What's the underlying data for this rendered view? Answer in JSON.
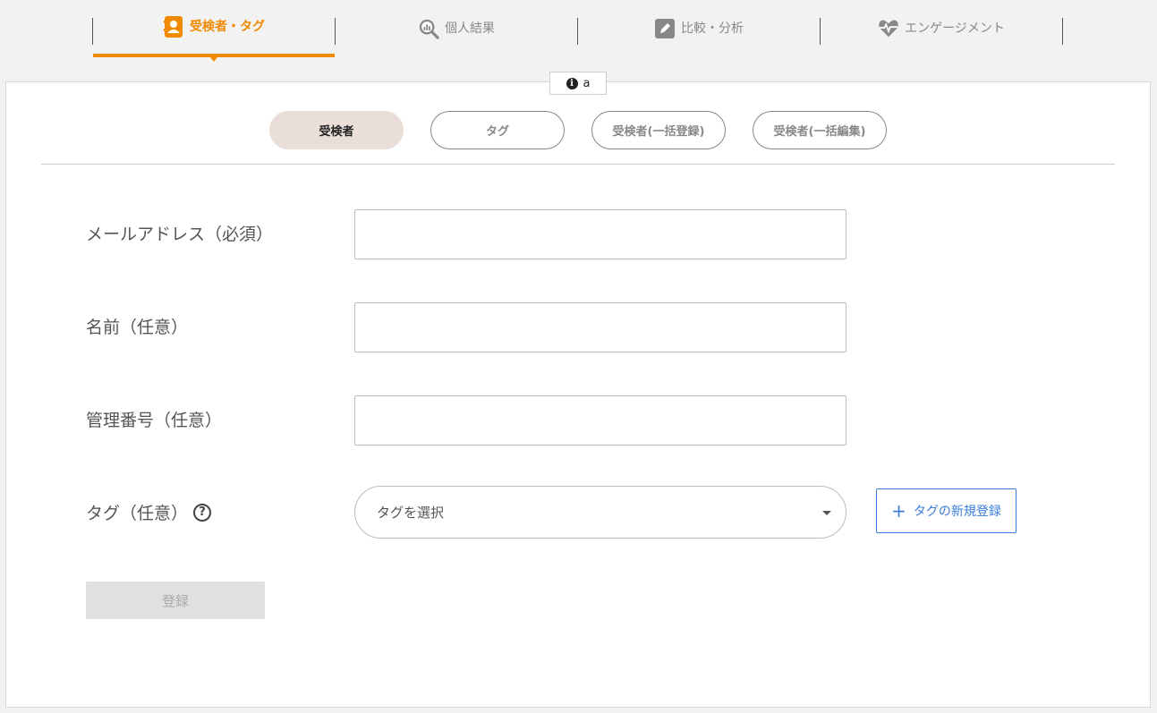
{
  "nav": {
    "tabs": [
      {
        "label": "受検者・タグ",
        "icon": "contact-book-icon",
        "active": true
      },
      {
        "label": "個人結果",
        "icon": "magnify-chart-icon",
        "active": false
      },
      {
        "label": "比較・分析",
        "icon": "pencil-square-icon",
        "active": false
      },
      {
        "label": "エンゲージメント",
        "icon": "heartbeat-icon",
        "active": false
      }
    ]
  },
  "info_chip": {
    "label": "a"
  },
  "subtabs": [
    "受検者",
    "タグ",
    "受検者(一括登録)",
    "受検者(一括編集)"
  ],
  "form": {
    "email_label": "メールアドレス（必須）",
    "name_label": "名前（任意）",
    "id_label": "管理番号（任意）",
    "tag_label": "タグ（任意）",
    "tag_placeholder": "タグを選択",
    "new_tag_label": "タグの新規登録",
    "submit_label": "登録"
  },
  "colors": {
    "accent": "#f08a00",
    "link": "#3b7dd8",
    "active_pill": "#eaded9"
  }
}
